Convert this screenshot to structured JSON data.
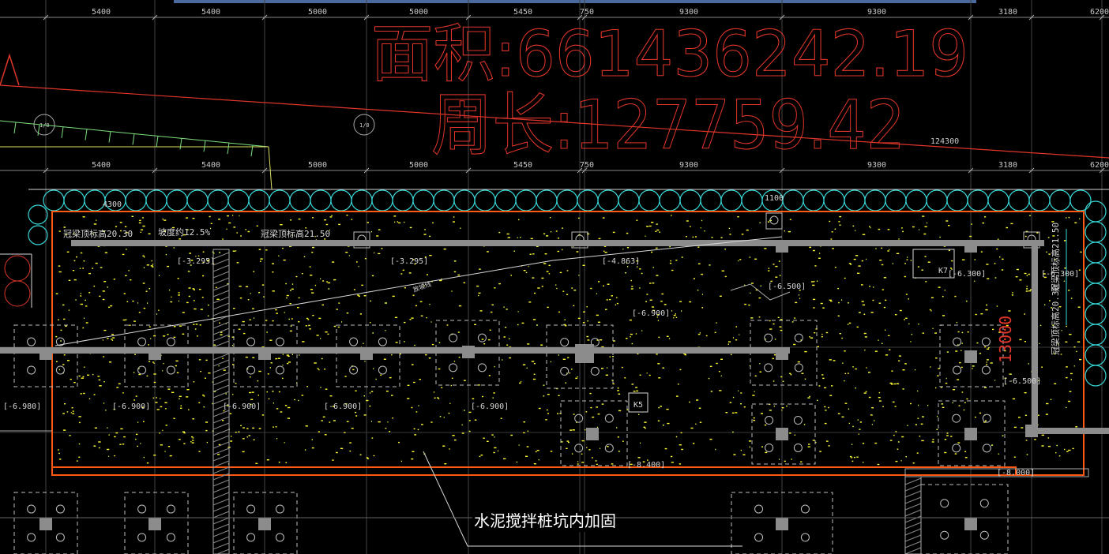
{
  "annotations": {
    "area_label": "面积:6614362​42.19",
    "perimeter_label": "周长:127759.42",
    "note_callout": "水泥搅拌桩坑内加固",
    "total_dimension": "124300",
    "height_dimension": "13000",
    "beam_top_left": "冠梁顶标高20.30",
    "slope_label": "坡度约12.5%",
    "beam_top_mid": "冠梁顶标高21.50",
    "beam_top_right_a": "冠梁顶标高21.50",
    "beam_top_right_b": "冠梁顶标高20.30",
    "ramp_label": "放坡线",
    "dimension_4300": "4300",
    "dimension_1100": "1100"
  },
  "axis_dimensions_top": [
    "5400",
    "5400",
    "5000",
    "5000",
    "5450",
    "750",
    "9300",
    "9300",
    "3180",
    "6200"
  ],
  "axis_dimensions_mid": [
    "5400",
    "5400",
    "5000",
    "5000",
    "5450",
    "750",
    "9300",
    "9300",
    "3180",
    "6200"
  ],
  "elevation_labels": [
    "[-3.295]",
    "[-3.295]",
    "[-4.863]",
    "[-6.500]",
    "[-6.900]",
    "[-6.300]",
    "[-6.300]",
    "[-6.980]",
    "[-6.900]",
    "[-6.900]",
    "[-6.900]",
    "[-6.900]",
    "[-8.400]",
    "[-6.500]",
    "[-8.000]"
  ],
  "axis_bubbles": [
    "1/0",
    "1/0"
  ],
  "tags": [
    "K7",
    "K5"
  ],
  "colors": {
    "background": "#000000",
    "pit_outline": "#ff5a14",
    "pile_circles": "#38d8d8",
    "fill_dots": "#ffff33",
    "beams": "#8c8c8c",
    "annotation_red": "#e0352a",
    "grid": "#5a5a5a",
    "dimension_text": "#c8c8c8"
  }
}
